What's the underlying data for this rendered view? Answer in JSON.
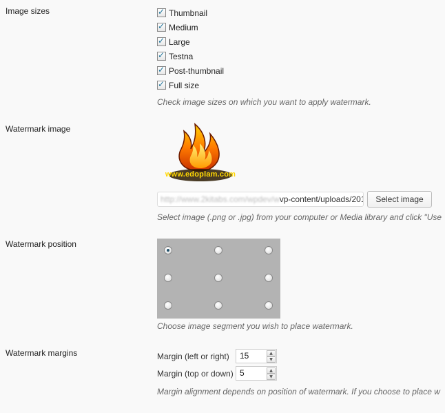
{
  "image_sizes": {
    "label": "Image sizes",
    "options": [
      {
        "label": "Thumbnail",
        "checked": true
      },
      {
        "label": "Medium",
        "checked": true
      },
      {
        "label": "Large",
        "checked": true
      },
      {
        "label": "Testna",
        "checked": true
      },
      {
        "label": "Post-thumbnail",
        "checked": true
      },
      {
        "label": "Full size",
        "checked": true
      }
    ],
    "description": "Check image sizes on which you want to apply watermark."
  },
  "watermark_image": {
    "label": "Watermark image",
    "logo_text": "www.edoplam.com",
    "url_blurred": "http://www.2kitabs.com/wpdev/w",
    "url_visible": "vp-content/uploads/201",
    "select_button": "Select image",
    "description": "Select image (.png or .jpg) from your computer or Media library and click \"Use"
  },
  "watermark_position": {
    "label": "Watermark position",
    "selected": "top-left",
    "description": "Choose image segment you wish to place watermark."
  },
  "watermark_margins": {
    "label": "Watermark margins",
    "left_right_label": "Margin (left or right)",
    "left_right_value": "15",
    "top_down_label": "Margin (top or down)",
    "top_down_value": "5",
    "description": "Margin alignment depends on position of watermark. If you choose to place w"
  },
  "colors": {
    "background": "#f9f9f9",
    "grid_background": "#b3b3b3",
    "logo_text": "#ffd700",
    "flame_outer": "#e85a00",
    "flame_inner": "#ffcc00"
  },
  "icons": {
    "checkbox": "checkmark-icon",
    "spinner_up": "arrow-up-icon",
    "spinner_down": "arrow-down-icon",
    "logo": "flame-logo-icon"
  }
}
